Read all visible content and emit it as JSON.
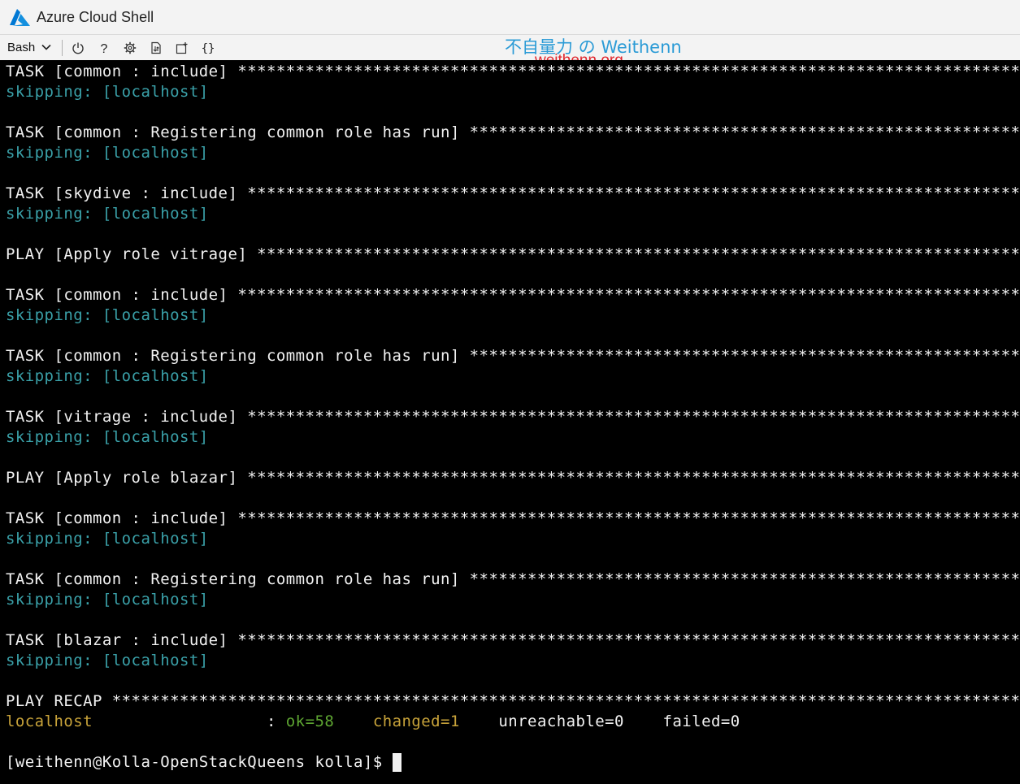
{
  "window": {
    "title": "Azure Cloud Shell",
    "logo_icon": "azure-logo-icon",
    "accent_color": "#0078d4"
  },
  "toolbar": {
    "shell": "Bash",
    "buttons": [
      {
        "name": "restart-button",
        "icon": "power-icon"
      },
      {
        "name": "help-button",
        "icon": "question-icon"
      },
      {
        "name": "settings-button",
        "icon": "gear-icon"
      },
      {
        "name": "upload-download-button",
        "icon": "file-transfer-icon"
      },
      {
        "name": "new-session-button",
        "icon": "new-session-icon"
      },
      {
        "name": "editor-button",
        "icon": "braces-icon"
      }
    ]
  },
  "watermark": {
    "line1": "不自量力 の Weithenn",
    "line2": "weithenn.org"
  },
  "terminal": {
    "colors": {
      "background": "#000000",
      "text": "#f2f2f2",
      "skipping": "#3aa0a8",
      "host": "#c8a33a",
      "ok": "#5ea632"
    },
    "lines": [
      {
        "text": "TASK [common : include] ************************************************************************************************",
        "style": "white"
      },
      {
        "text": "skipping: [localhost]",
        "style": "teal"
      },
      {
        "text": "",
        "style": "white"
      },
      {
        "text": "TASK [common : Registering common role has run] ***********************************************************************",
        "style": "white"
      },
      {
        "text": "skipping: [localhost]",
        "style": "teal"
      },
      {
        "text": "",
        "style": "white"
      },
      {
        "text": "TASK [skydive : include] ***********************************************************************************************",
        "style": "white"
      },
      {
        "text": "skipping: [localhost]",
        "style": "teal"
      },
      {
        "text": "",
        "style": "white"
      },
      {
        "text": "PLAY [Apply role vitrage] **********************************************************************************************",
        "style": "white"
      },
      {
        "text": "",
        "style": "white"
      },
      {
        "text": "TASK [common : include] ************************************************************************************************",
        "style": "white"
      },
      {
        "text": "skipping: [localhost]",
        "style": "teal"
      },
      {
        "text": "",
        "style": "white"
      },
      {
        "text": "TASK [common : Registering common role has run] ***********************************************************************",
        "style": "white"
      },
      {
        "text": "skipping: [localhost]",
        "style": "teal"
      },
      {
        "text": "",
        "style": "white"
      },
      {
        "text": "TASK [vitrage : include] ***********************************************************************************************",
        "style": "white"
      },
      {
        "text": "skipping: [localhost]",
        "style": "teal"
      },
      {
        "text": "",
        "style": "white"
      },
      {
        "text": "PLAY [Apply role blazar] ***********************************************************************************************",
        "style": "white"
      },
      {
        "text": "",
        "style": "white"
      },
      {
        "text": "TASK [common : include] ************************************************************************************************",
        "style": "white"
      },
      {
        "text": "skipping: [localhost]",
        "style": "teal"
      },
      {
        "text": "",
        "style": "white"
      },
      {
        "text": "TASK [common : Registering common role has run] ***********************************************************************",
        "style": "white"
      },
      {
        "text": "skipping: [localhost]",
        "style": "teal"
      },
      {
        "text": "",
        "style": "white"
      },
      {
        "text": "TASK [blazar : include] ************************************************************************************************",
        "style": "white"
      },
      {
        "text": "skipping: [localhost]",
        "style": "teal"
      },
      {
        "text": "",
        "style": "white"
      },
      {
        "text": "PLAY RECAP *************************************************************************************************************",
        "style": "white"
      }
    ],
    "recap": {
      "host": "localhost",
      "sep": "                  : ",
      "ok": "ok=58",
      "gap1": "    ",
      "changed": "changed=1",
      "gap2": "    ",
      "unreachable": "unreachable=0",
      "gap3": "    ",
      "failed": "failed=0"
    },
    "prompt": "[weithenn@Kolla-OpenStackQueens kolla]$ "
  }
}
